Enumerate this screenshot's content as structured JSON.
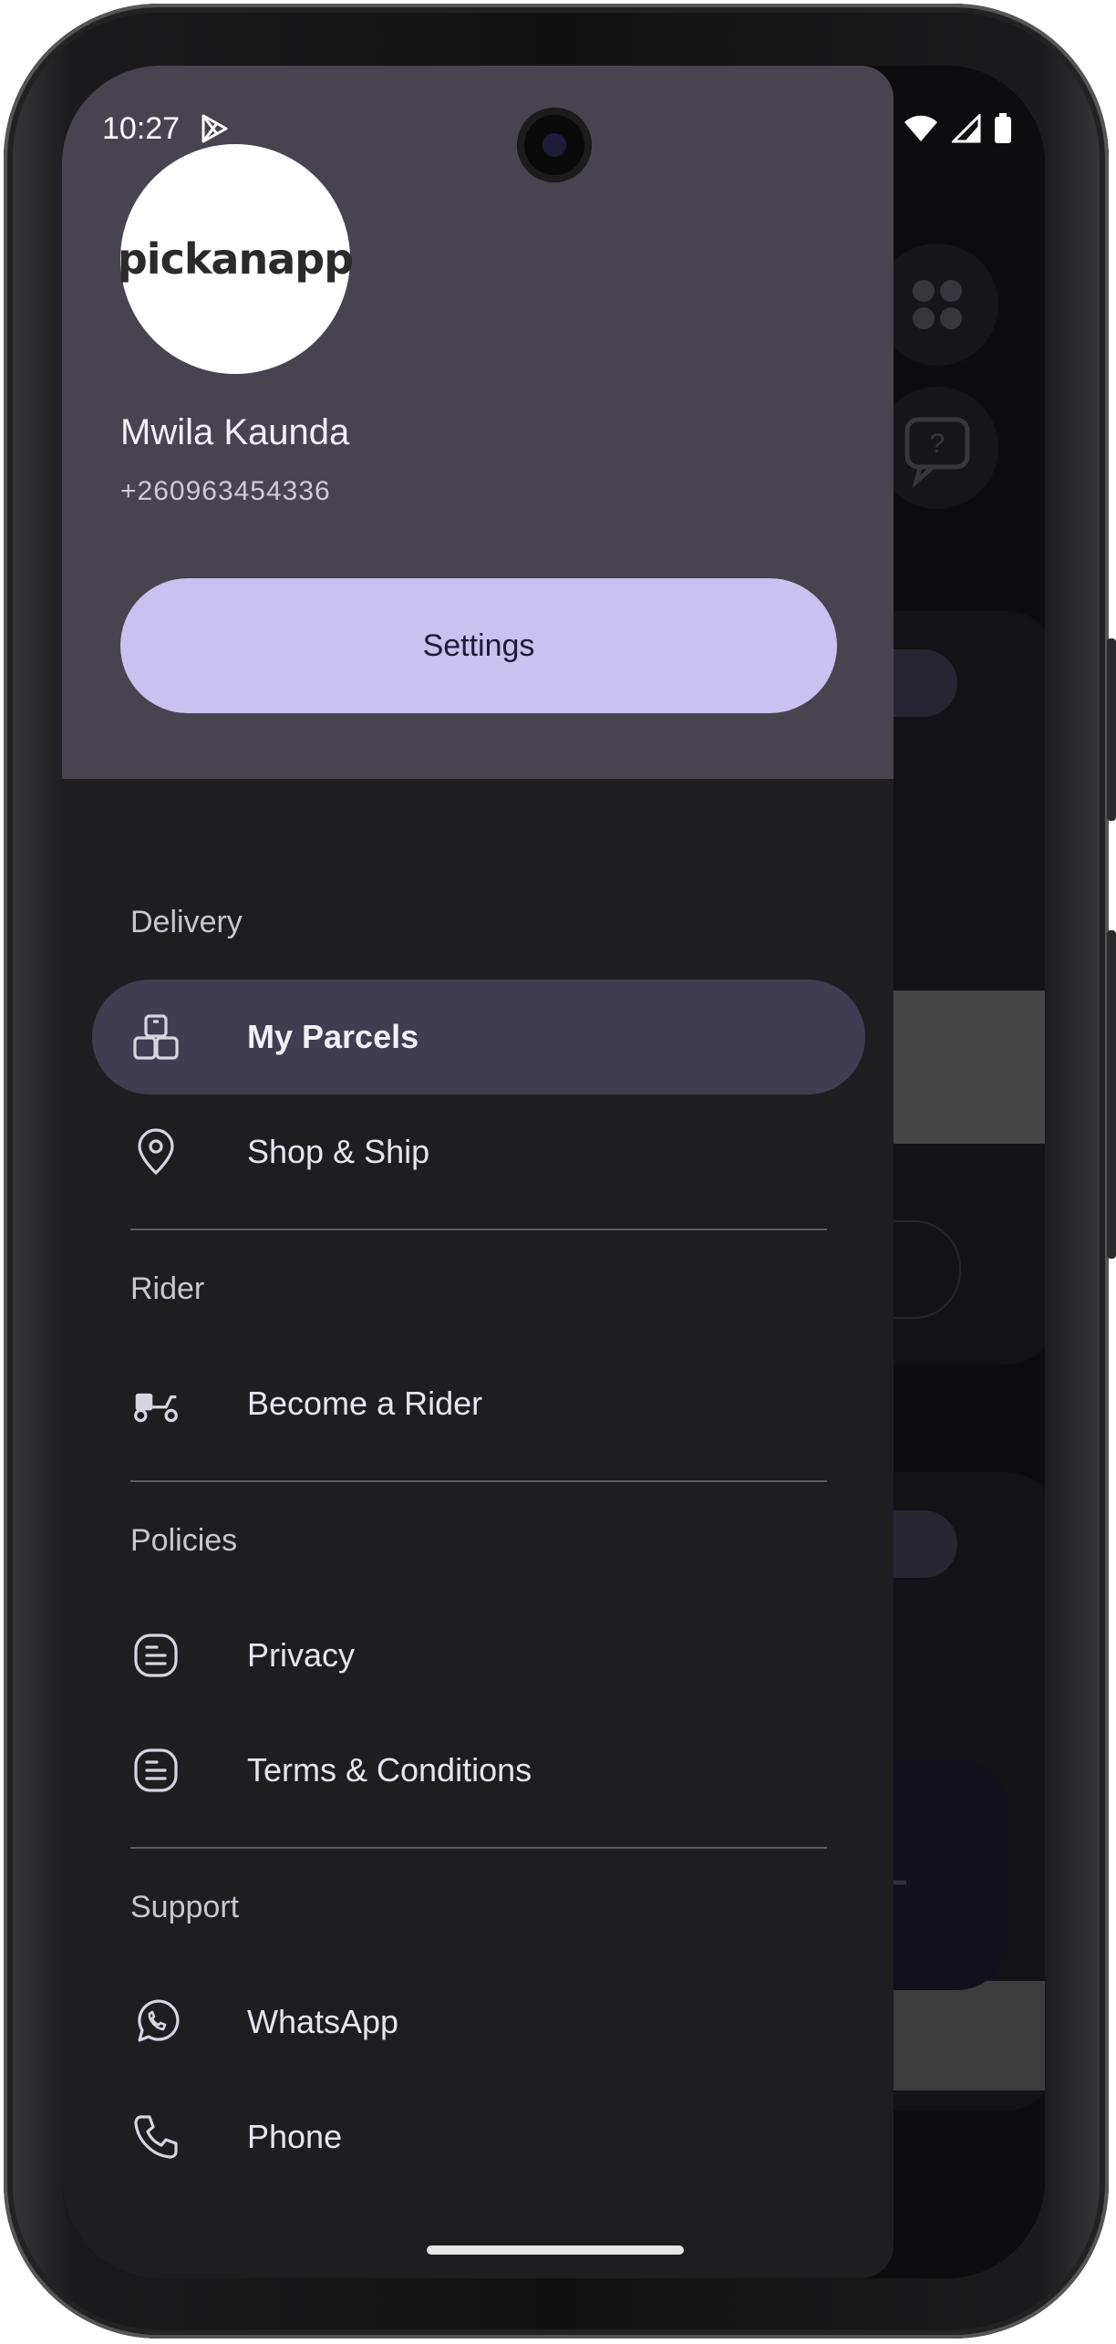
{
  "status_bar": {
    "time": "10:27",
    "icons": [
      "play-store-icon",
      "wifi-icon",
      "signal-icon",
      "battery-icon"
    ]
  },
  "drawer": {
    "logo_text": "pickanapp",
    "user_name": "Mwila Kaunda",
    "user_phone": "+260963454336",
    "settings_label": "Settings",
    "sections": [
      {
        "label": "Delivery",
        "items": [
          {
            "label": "My Parcels",
            "icon": "parcels-icon",
            "active": true
          },
          {
            "label": "Shop & Ship",
            "icon": "location-pin-icon",
            "active": false
          }
        ]
      },
      {
        "label": "Rider",
        "items": [
          {
            "label": "Become a Rider",
            "icon": "scooter-icon",
            "active": false
          }
        ]
      },
      {
        "label": "Policies",
        "items": [
          {
            "label": "Privacy",
            "icon": "document-icon",
            "active": false
          },
          {
            "label": "Terms & Conditions",
            "icon": "document-icon",
            "active": false
          }
        ]
      },
      {
        "label": "Support",
        "items": [
          {
            "label": "WhatsApp",
            "icon": "whatsapp-icon",
            "active": false
          },
          {
            "label": "Phone",
            "icon": "phone-icon",
            "active": false
          }
        ]
      }
    ]
  },
  "colors": {
    "drawer_header_bg": "#47444f",
    "drawer_bg": "#1e1e21",
    "accent_button": "#c9c1f0",
    "active_item_bg": "#403d52"
  }
}
